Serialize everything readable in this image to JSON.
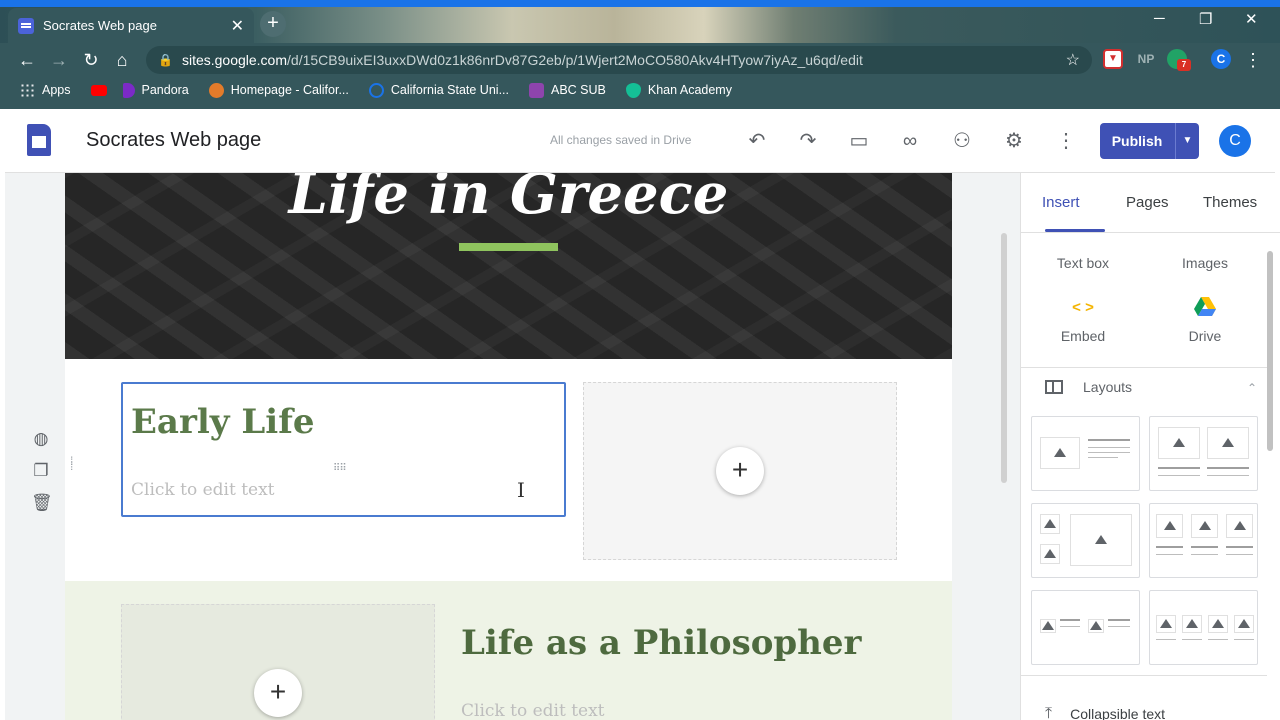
{
  "browser": {
    "tab_title": "Socrates Web page",
    "tab_close": "✕",
    "new_tab": "+",
    "url_host": "sites.google.com",
    "url_path": "/d/15CB9uixEI3uxxDWd0z1k86nrDv87G2eb/p/1Wjert2MoCO580Akv4HTyow7iyAz_u6qd/edit",
    "window_controls": [
      "─",
      "❐",
      "✕"
    ],
    "ext_np": "NP",
    "ext_badge": "7",
    "profile_initial": "C",
    "bookmarks": [
      {
        "label": "Apps",
        "color": "#e8eaed"
      },
      {
        "label": "",
        "color": "#ff0000"
      },
      {
        "label": "Pandora",
        "color": "#7b2ac7"
      },
      {
        "label": "Homepage - Califor...",
        "color": "#e37b2a"
      },
      {
        "label": "California State Uni...",
        "color": "#1a73e8"
      },
      {
        "label": "ABC SUB",
        "color": "#8e44ad"
      },
      {
        "label": "Khan Academy",
        "color": "#14bf96"
      }
    ]
  },
  "app": {
    "title": "Socrates Web page",
    "save_status": "All changes saved in Drive",
    "publish_label": "Publish",
    "publish_arrow": "▼",
    "avatar_initial": "C"
  },
  "page": {
    "hero_title": "Life in Greece",
    "section1_heading": "Early Life",
    "section1_placeholder": "Click to edit text",
    "section2_heading": "Life as a Philosopher",
    "section2_placeholder": "Click to edit text",
    "add_symbol": "+"
  },
  "panel": {
    "tabs": [
      "Insert",
      "Pages",
      "Themes"
    ],
    "active_tab": "Insert",
    "insert_items": [
      {
        "label": "Text box",
        "icon": "text-box-icon"
      },
      {
        "label": "Images",
        "icon": "image-icon"
      },
      {
        "label": "Embed",
        "icon": "embed-icon"
      },
      {
        "label": "Drive",
        "icon": "drive-icon"
      }
    ],
    "embed_glyph": "< >",
    "layouts_label": "Layouts",
    "collapse_glyph": "⌃",
    "collapsible_label": "Collapsible text",
    "accent_color": "#3f51b5"
  }
}
